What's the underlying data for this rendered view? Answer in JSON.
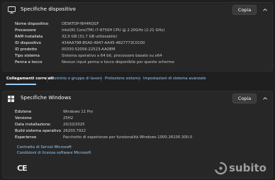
{
  "device_specs": {
    "title": "Specifiche dispositivo",
    "copy_label": "Copia",
    "rows": [
      {
        "label": "Nome dispositivo",
        "value": "DESKTOP-NH4RQGF"
      },
      {
        "label": "Processore",
        "value": "Intel(R) Core(TM) i7-8750H CPU @ 2.20GHz (2.21 GHz)"
      },
      {
        "label": "RAM installata",
        "value": "32,0 GB (31,7 GB utilizzabile)"
      },
      {
        "label": "ID dispositivo",
        "value": "434AA798-B5A0-4847-AA45-4827773C0100"
      },
      {
        "label": "ID prodotto",
        "value": "00330-52056-22523-AAOEM"
      },
      {
        "label": "Tipo sistema",
        "value": "Sistema operativo a 64 bit, processore basato su x64"
      },
      {
        "label": "Penna e tocco",
        "value": "Nessun input penna o tocco disponibile per questo schermo"
      }
    ]
  },
  "related": {
    "heading": "Collegamenti correlati",
    "links": [
      "Dominio o gruppo di lavoro",
      "Protezione sistema",
      "Impostazioni di sistema avanzate"
    ]
  },
  "windows_specs": {
    "title": "Specifiche Windows",
    "copy_label": "Copia",
    "rows": [
      {
        "label": "Edizione",
        "value": "Windows 11 Pro"
      },
      {
        "label": "Versione",
        "value": "25H2"
      },
      {
        "label": "Data installazione:",
        "value": "20/10/2025"
      },
      {
        "label": "Build sistema operativo",
        "value": "26200.7922"
      },
      {
        "label": "Esperienza",
        "value": "Pacchetto di esperienze per funzionalità Windows 1000.26100.300.0"
      }
    ],
    "links": [
      "Contratto di Servizi Microsoft",
      "Condizioni di licenza software Microsoft"
    ]
  },
  "ce_mark": "CE",
  "watermark": "subito"
}
